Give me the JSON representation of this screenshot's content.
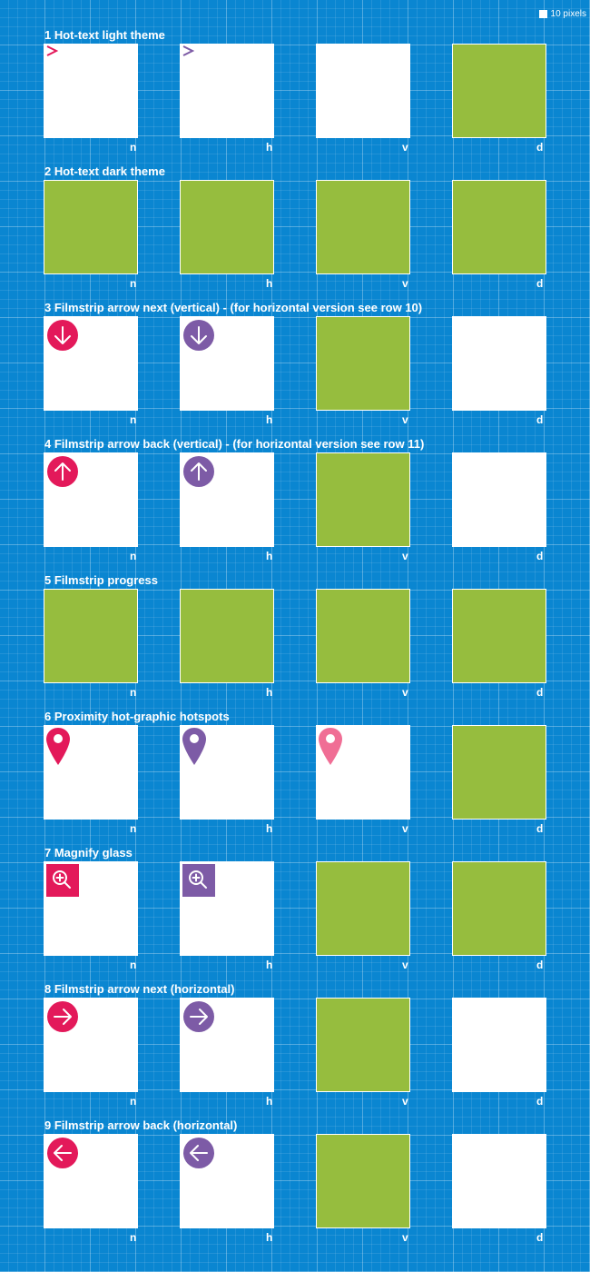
{
  "legend": {
    "label": "10 pixels"
  },
  "states": [
    "n",
    "h",
    "v",
    "d"
  ],
  "colors": {
    "background": "#0a86d1",
    "green": "#96bd3e",
    "magenta": "#e3195a",
    "purple": "#7d5ba6",
    "pink": "#f06e95"
  },
  "rows": [
    {
      "title": "1 Hot-text light theme",
      "icons": [
        "chevron-right-icon",
        "chevron-right-icon",
        null,
        null
      ],
      "greens": [
        false,
        false,
        false,
        true
      ]
    },
    {
      "title": "2 Hot-text dark theme",
      "icons": [
        null,
        null,
        null,
        null
      ],
      "greens": [
        true,
        true,
        true,
        true
      ]
    },
    {
      "title": "3 Filmstrip arrow next (vertical) - (for horizontal version see row 10)",
      "icons": [
        "arrow-down-circle-icon",
        "arrow-down-circle-icon",
        null,
        null
      ],
      "greens": [
        false,
        false,
        true,
        false
      ]
    },
    {
      "title": "4 Filmstrip arrow back (vertical) - (for horizontal version see row 11)",
      "icons": [
        "arrow-up-circle-icon",
        "arrow-up-circle-icon",
        null,
        null
      ],
      "greens": [
        false,
        false,
        true,
        false
      ]
    },
    {
      "title": "5 Filmstrip progress",
      "icons": [
        null,
        null,
        null,
        null
      ],
      "greens": [
        true,
        true,
        true,
        true
      ]
    },
    {
      "title": "6 Proximity hot-graphic hotspots",
      "icons": [
        "map-pin-icon",
        "map-pin-icon",
        "map-pin-icon",
        null
      ],
      "greens": [
        false,
        false,
        false,
        true
      ]
    },
    {
      "title": "7 Magnify glass",
      "icons": [
        "zoom-in-icon",
        "zoom-in-icon",
        null,
        null
      ],
      "greens": [
        false,
        false,
        true,
        true
      ]
    },
    {
      "title": "8 Filmstrip arrow next (horizontal)",
      "icons": [
        "arrow-right-circle-icon",
        "arrow-right-circle-icon",
        null,
        null
      ],
      "greens": [
        false,
        false,
        true,
        false
      ]
    },
    {
      "title": "9 Filmstrip arrow back (horizontal)",
      "icons": [
        "arrow-left-circle-icon",
        "arrow-left-circle-icon",
        null,
        null
      ],
      "greens": [
        false,
        false,
        true,
        false
      ]
    }
  ]
}
